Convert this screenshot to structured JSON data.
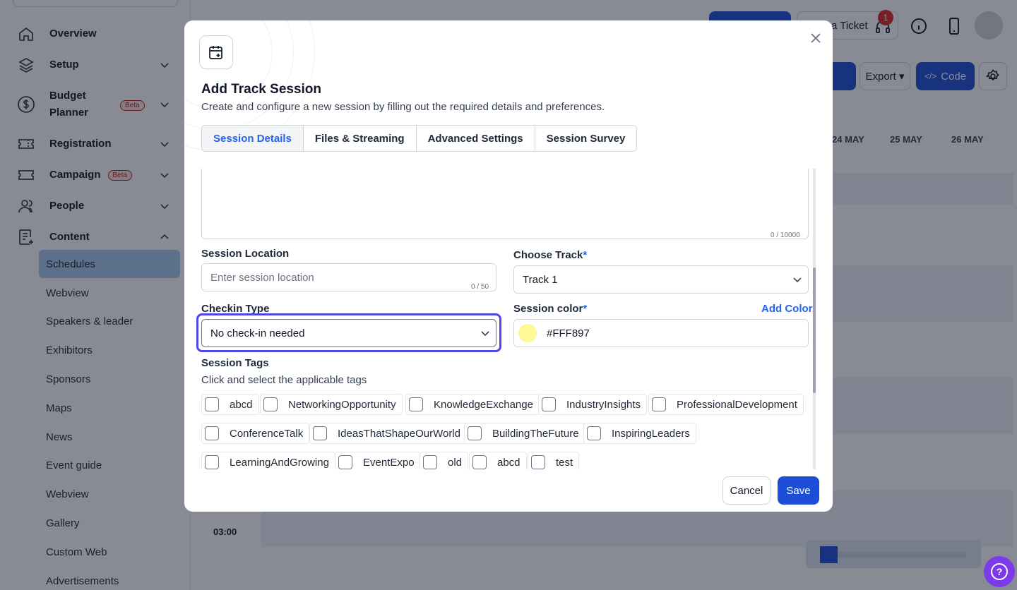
{
  "sidebar": {
    "items": [
      {
        "label": "Overview",
        "icon": "home-icon",
        "beta": ""
      },
      {
        "label": "Setup",
        "icon": "layers-icon",
        "beta": ""
      },
      {
        "label": "Budget",
        "label2": "Planner",
        "icon": "dollar-icon",
        "beta": "Beta"
      },
      {
        "label": "Registration",
        "icon": "ticket-icon",
        "beta": ""
      },
      {
        "label": "Campaign",
        "icon": "campaign-icon",
        "beta": "Beta"
      },
      {
        "label": "People",
        "icon": "people-icon",
        "beta": ""
      },
      {
        "label": "Content",
        "icon": "content-icon",
        "beta": ""
      }
    ],
    "content_sub": [
      "Schedules",
      "Webview",
      "Speakers & leader",
      "Exhibitors",
      "Sponsors",
      "Maps",
      "News",
      "Event guide",
      "Webview",
      "Gallery",
      "Custom Web",
      "Advertisements"
    ]
  },
  "background": {
    "ticket_label": "a Ticket",
    "notification_count": "1",
    "export_label": "Export",
    "code_label": "Code",
    "dates": [
      "24 MAY",
      "25 MAY",
      "26 MAY"
    ],
    "time": "03:00"
  },
  "modal": {
    "title": "Add Track Session",
    "subtitle": "Create and configure a new session by filling out the required details and preferences.",
    "tabs": [
      "Session Details",
      "Files & Streaming",
      "Advanced Settings",
      "Session Survey"
    ],
    "description_counter": "0 / 10000",
    "location": {
      "label": "Session Location",
      "placeholder": "Enter session location",
      "counter": "0 / 50"
    },
    "track": {
      "label": "Choose Track",
      "required": "*",
      "value": "Track 1"
    },
    "checkin": {
      "label": "Checkin Type",
      "value": "No check-in needed"
    },
    "color": {
      "label": "Session color",
      "required": "*",
      "add_label": "Add Color",
      "value": "#FFF897",
      "swatch": "#fff897"
    },
    "tags": {
      "label": "Session Tags",
      "hint": "Click and select the applicable tags",
      "items": [
        "abcd",
        "NetworkingOpportunity",
        "KnowledgeExchange",
        "IndustryInsights",
        "ProfessionalDevelopment",
        "ConferenceTalk",
        "IdeasThatShapeOurWorld",
        "BuildingTheFuture",
        "InspiringLeaders",
        "LearningAndGrowing",
        "EventExpo",
        "old",
        "abcd",
        "test"
      ]
    },
    "cancel_label": "Cancel",
    "save_label": "Save"
  },
  "colors": {
    "primary": "#1d4ed8",
    "accent": "#2563eb",
    "focus": "#4f46e5",
    "active_nav": "#a8c8ea"
  }
}
